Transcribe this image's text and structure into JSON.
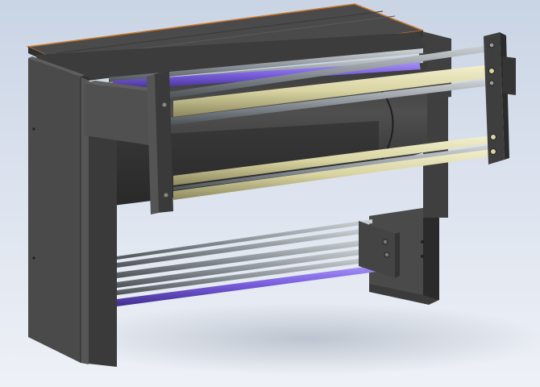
{
  "scene": {
    "subject": "cad-render-industrial-roller-machine",
    "colors": {
      "background_top": "#c9d4e4",
      "background_bottom": "#eef1f6",
      "frame": "#454545",
      "frame_dark": "#2e2e2e",
      "frame_light": "#5c5c5c",
      "top_edge": "#c8752a",
      "roller_grey": "#8f969c",
      "roller_purple": "#7b5fe0",
      "roller_cream": "#d9d4a2"
    }
  }
}
